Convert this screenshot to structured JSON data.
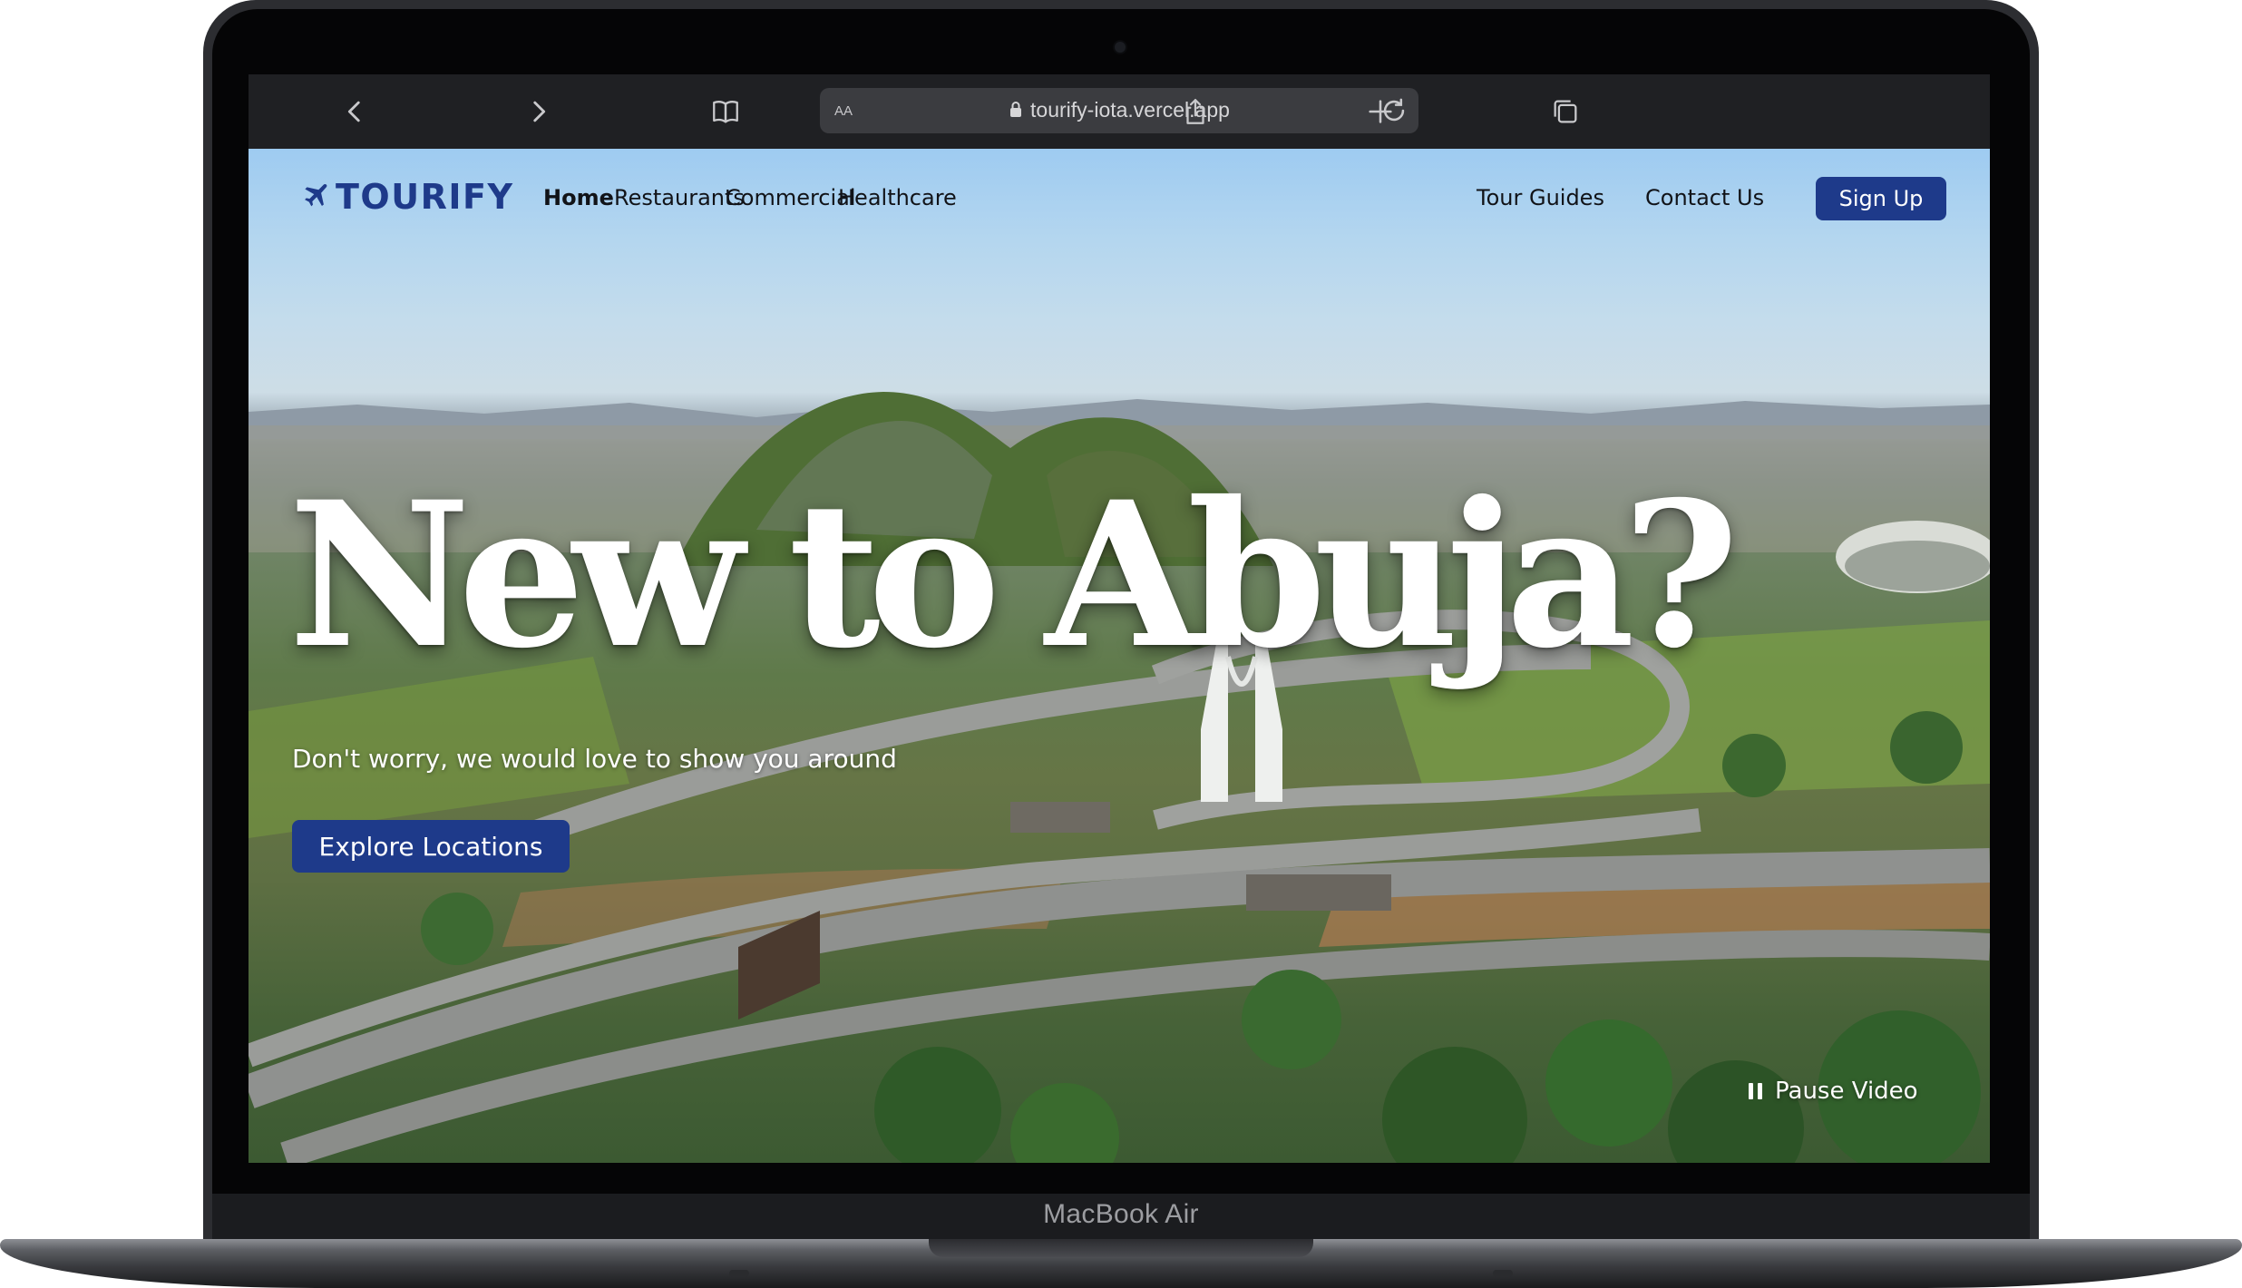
{
  "device": {
    "label": "MacBook Air"
  },
  "browser": {
    "address_prefix": "AA",
    "url": "tourify-iota.vercel.app",
    "icons": [
      "chevron-left-icon",
      "chevron-right-icon",
      "book-icon",
      "lock-icon",
      "reload-icon",
      "share-icon",
      "plus-icon",
      "tabs-icon"
    ]
  },
  "site": {
    "logo": "TOURIFY",
    "nav": {
      "home": "Home",
      "restaurants": "Restaurants",
      "commercial": "Commercial",
      "healthcare": "Healthcare",
      "tour_guides": "Tour Guides",
      "contact_us": "Contact Us"
    },
    "signup_label": "Sign Up",
    "hero": {
      "headline": "New to Abuja?",
      "subtitle": "Don't worry, we would love to show you around",
      "cta_label": "Explore Locations",
      "pause_label": "Pause Video"
    }
  },
  "colors": {
    "brand": "#1e3a8a",
    "toolbar": "#1f2023",
    "address_bar": "#3b3c40"
  }
}
